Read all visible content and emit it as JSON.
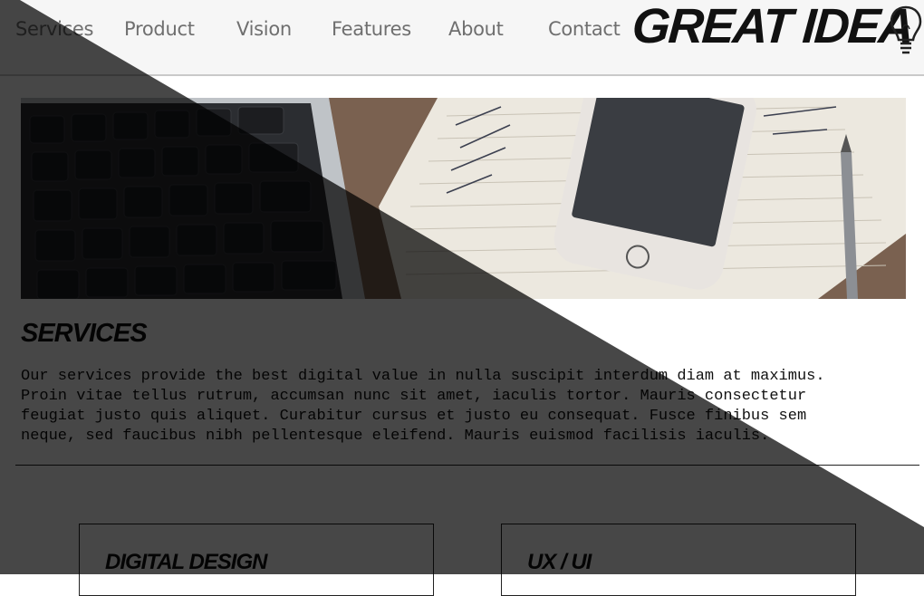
{
  "nav": {
    "links": [
      {
        "label": "Services"
      },
      {
        "label": "Product"
      },
      {
        "label": "Vision"
      },
      {
        "label": "Features"
      },
      {
        "label": "About"
      },
      {
        "label": "Contact"
      }
    ],
    "logo_text": "GREAT IDEA",
    "logo_icon": "lightbulb-icon"
  },
  "hero": {
    "image": "desk-with-laptop-keyboard-phone-notebook"
  },
  "services": {
    "title": "SERVICES",
    "body": "Our services provide the best digital value in nulla suscipit interdum diam at maximus.\nProin vitae tellus rutrum, accumsan nunc sit amet, iaculis tortor. Mauris consectetur\nfeugiat justo quis aliquet. Curabitur cursus et justo eu consequat. Fusce finibus sem\nneque, sed faucibus nibh pellentesque eleifend. Mauris euismod facilisis iaculis."
  },
  "cards": [
    {
      "title": "DIGITAL DESIGN"
    },
    {
      "title": "UX / UI"
    }
  ],
  "colors": {
    "nav_bg": "#f6f6f6",
    "nav_text": "#6f6f6f",
    "text": "#111111",
    "shade": "rgba(0,0,0,0.72)"
  }
}
